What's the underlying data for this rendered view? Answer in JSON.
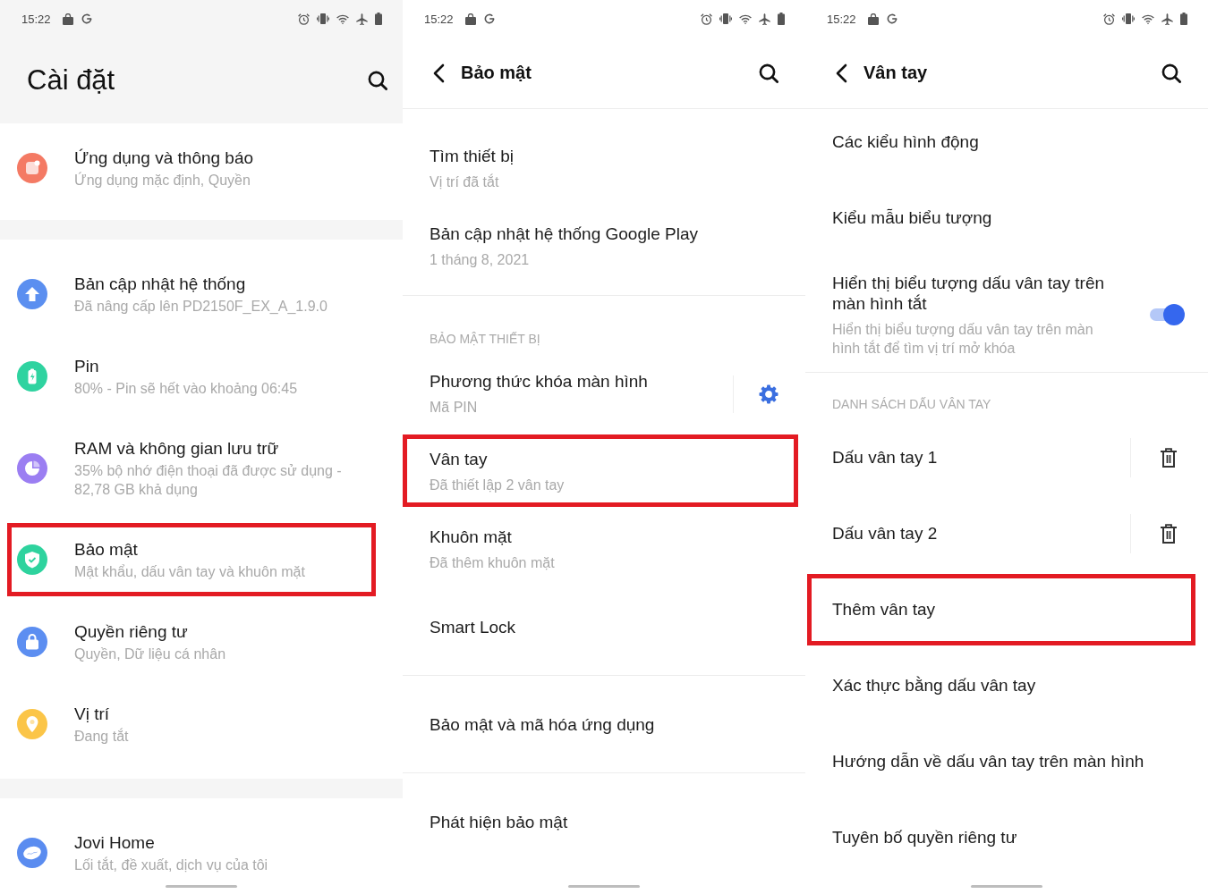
{
  "screens": [
    {
      "status_bar": {
        "time": "15:22"
      },
      "header": {
        "kind": "large",
        "title": "Cài đặt"
      },
      "groups": [
        {
          "items": [
            {
              "kind": "icon",
              "title": "Ứng dụng và thông báo",
              "subtitle": "Ứng dụng mặc định, Quyền",
              "color": "#f47a64",
              "highlighted": false
            }
          ]
        },
        {
          "items": [
            {
              "kind": "icon",
              "title": "Bản cập nhật hệ thống",
              "subtitle": "Đã nâng cấp lên PD2150F_EX_A_1.9.0",
              "color": "#5b8ff0",
              "highlighted": false
            },
            {
              "kind": "icon",
              "title": "Pin",
              "subtitle": "80% - Pin sẽ hết vào khoảng 06:45",
              "color": "#2fd3a0",
              "highlighted": false
            },
            {
              "kind": "icon",
              "title": "RAM và không gian lưu trữ",
              "subtitle": "35% bộ nhớ điện thoại đã được sử dụng - 82,78 GB khả dụng",
              "color": "#9b7ef2",
              "highlighted": false
            },
            {
              "kind": "icon",
              "title": "Bảo mật",
              "subtitle": "Mật khẩu, dấu vân tay và khuôn mặt",
              "color": "#2ed39e",
              "highlighted": true
            },
            {
              "kind": "icon",
              "title": "Quyền riêng tư",
              "subtitle": "Quyền, Dữ liệu cá nhân",
              "color": "#5c8ef1",
              "highlighted": false
            },
            {
              "kind": "icon",
              "title": "Vị trí",
              "subtitle": "Đang tắt",
              "color": "#fbc548",
              "highlighted": false
            }
          ]
        },
        {
          "items": [
            {
              "kind": "icon",
              "title": "Jovi Home",
              "subtitle": "Lối tắt, đề xuất, dịch vụ của tôi",
              "color": "#5a8cf0",
              "highlighted": false
            }
          ]
        }
      ]
    },
    {
      "status_bar": {
        "time": "15:22"
      },
      "header": {
        "kind": "back",
        "title": "Bảo mật"
      },
      "groups": [
        {
          "items": [
            {
              "kind": "plain",
              "title": "Tìm thiết bị",
              "subtitle": "Vị trí đã tắt",
              "highlighted": false
            },
            {
              "kind": "plain",
              "title": "Bản cập nhật hệ thống Google Play",
              "subtitle": "1 tháng 8, 2021",
              "highlighted": false
            }
          ]
        },
        {
          "section_title": "BẢO MẬT THIẾT BỊ",
          "items": [
            {
              "kind": "settings",
              "title": "Phương thức khóa màn hình",
              "subtitle": "Mã PIN",
              "highlighted": false
            },
            {
              "kind": "plain",
              "title": "Vân tay",
              "subtitle": "Đã thiết lập 2 vân tay",
              "highlighted": true
            },
            {
              "kind": "plain",
              "title": "Khuôn mặt",
              "subtitle": "Đã thêm khuôn mặt",
              "highlighted": false
            },
            {
              "kind": "plain",
              "title": "Smart Lock",
              "highlighted": false
            }
          ]
        },
        {
          "items": [
            {
              "kind": "plain",
              "title": "Bảo mật và mã hóa ứng dụng",
              "highlighted": false
            }
          ]
        },
        {
          "items": [
            {
              "kind": "plain",
              "title": "Phát hiện bảo mật",
              "highlighted": false
            }
          ]
        }
      ]
    },
    {
      "status_bar": {
        "time": "15:22"
      },
      "header": {
        "kind": "back",
        "title": "Vân tay"
      },
      "groups": [
        {
          "items": [
            {
              "kind": "plain",
              "title": "Các kiểu hình động",
              "highlighted": false
            },
            {
              "kind": "plain",
              "title": "Kiểu mẫu biểu tượng",
              "highlighted": false
            },
            {
              "kind": "toggle",
              "title": "Hiển thị biểu tượng dấu vân tay trên màn hình tắt",
              "subtitle": "Hiển thị biểu tượng dấu vân tay trên màn hình tắt để tìm vị trí mở khóa",
              "on": true,
              "highlighted": false
            }
          ]
        },
        {
          "section_title": "DANH SÁCH DẤU VÂN TAY",
          "items": [
            {
              "kind": "delete",
              "title": "Dấu vân tay 1",
              "highlighted": false
            },
            {
              "kind": "delete",
              "title": "Dấu vân tay 2",
              "highlighted": false
            },
            {
              "kind": "plain",
              "title": "Thêm vân tay",
              "highlighted": true
            },
            {
              "kind": "plain",
              "title": "Xác thực bằng dấu vân tay",
              "highlighted": false
            },
            {
              "kind": "plain",
              "title": "Hướng dẫn về dấu vân tay trên màn hình",
              "highlighted": false
            },
            {
              "kind": "plain",
              "title": "Tuyên bố quyền riêng tư",
              "highlighted": false
            }
          ]
        }
      ]
    }
  ]
}
